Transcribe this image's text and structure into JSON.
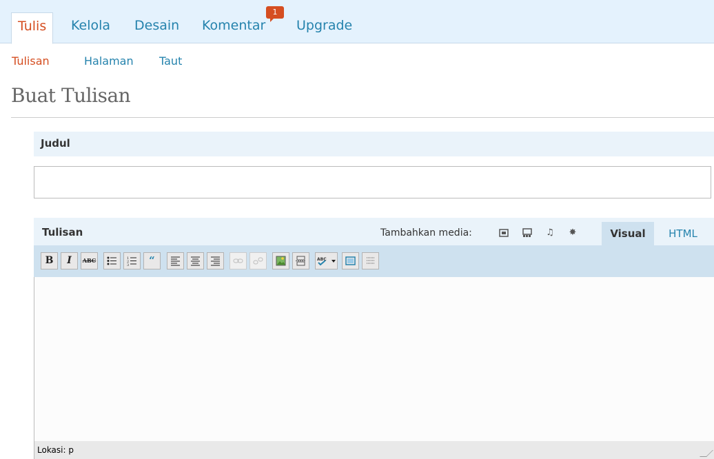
{
  "nav": {
    "tabs": [
      {
        "label": "Tulis",
        "active": true
      },
      {
        "label": "Kelola",
        "active": false
      },
      {
        "label": "Desain",
        "active": false
      },
      {
        "label": "Komentar",
        "active": false,
        "badge": "1"
      },
      {
        "label": "Upgrade",
        "active": false
      }
    ],
    "subtabs": [
      {
        "label": "Tulisan",
        "active": true
      },
      {
        "label": "Halaman",
        "active": false
      },
      {
        "label": "Taut",
        "active": false
      }
    ]
  },
  "page": {
    "title": "Buat Tulisan"
  },
  "title_section": {
    "heading": "Judul",
    "value": "",
    "placeholder": ""
  },
  "post_section": {
    "heading": "Tulisan",
    "media_label": "Tambahkan media:",
    "media_icons": [
      "image-icon",
      "gallery-icon",
      "audio-icon",
      "media-other-icon"
    ],
    "editor_tabs": [
      {
        "label": "Visual",
        "active": true
      },
      {
        "label": "HTML",
        "active": false
      }
    ],
    "toolbar": [
      "bold",
      "italic",
      "strikethrough",
      "bullet-list",
      "numbered-list",
      "blockquote",
      "align-left",
      "align-center",
      "align-right",
      "link",
      "unlink",
      "insert-image",
      "more-tag",
      "spellcheck",
      "spellcheck-dropdown",
      "fullscreen",
      "kitchen-sink"
    ],
    "content": "",
    "status": "Lokasi: p"
  },
  "colors": {
    "accent": "#d54e21",
    "link": "#2583ad",
    "nav_bg": "#e4f2fd",
    "toolbar_bg": "#cee1ef"
  }
}
